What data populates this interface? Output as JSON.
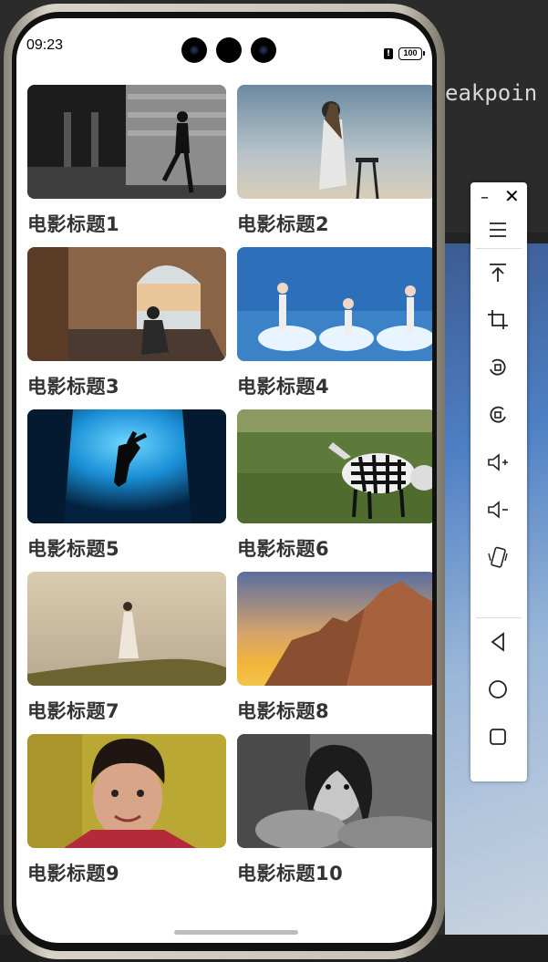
{
  "ide": {
    "code_fragment": "eakpoin"
  },
  "status_bar": {
    "time": "09:23",
    "battery": "100"
  },
  "movies": [
    {
      "title": "电影标题1"
    },
    {
      "title": "电影标题2"
    },
    {
      "title": "电影标题3"
    },
    {
      "title": "电影标题4"
    },
    {
      "title": "电影标题5"
    },
    {
      "title": "电影标题6"
    },
    {
      "title": "电影标题7"
    },
    {
      "title": "电影标题8"
    },
    {
      "title": "电影标题9"
    },
    {
      "title": "电影标题10"
    }
  ],
  "toolbar": {
    "icons": [
      "minimize-icon",
      "close-icon",
      "menu-icon",
      "pin-top-icon",
      "crop-icon",
      "rotate-left-icon",
      "rotate-right-icon",
      "volume-up-icon",
      "volume-down-icon",
      "shake-icon",
      "back-icon",
      "home-icon",
      "recents-icon"
    ]
  }
}
